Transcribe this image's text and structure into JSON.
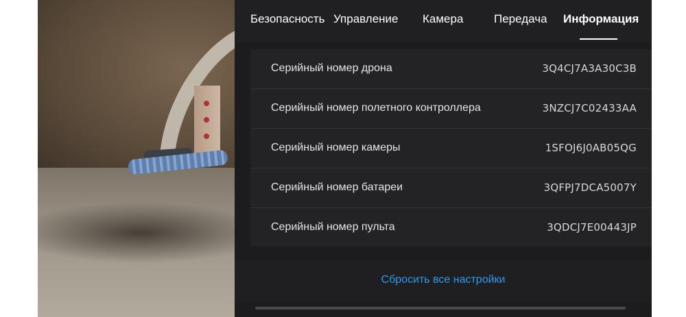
{
  "tabs": [
    {
      "label": "Безопасность"
    },
    {
      "label": "Управление"
    },
    {
      "label": "Камера"
    },
    {
      "label": "Передача"
    },
    {
      "label": "Информация"
    }
  ],
  "active_tab": "Информация",
  "info": [
    {
      "label": "Серийный номер дрона",
      "value": "3Q4CJ7A3A30C3B"
    },
    {
      "label": "Серийный номер полетного контроллера",
      "value": "3NZCJ7C02433AA"
    },
    {
      "label": "Серийный номер камеры",
      "value": "1SFOJ6J0AB05QG"
    },
    {
      "label": "Серийный номер батареи",
      "value": "3QFPJ7DCA5007Y"
    },
    {
      "label": "Серийный номер пульта",
      "value": "3QDCJ7E00443JP"
    }
  ],
  "reset": {
    "label": "Сбросить все настройки"
  },
  "colors": {
    "accent": "#2d9cf0",
    "panel_bg": "#1c1c1e",
    "row_bg": "#232325"
  }
}
